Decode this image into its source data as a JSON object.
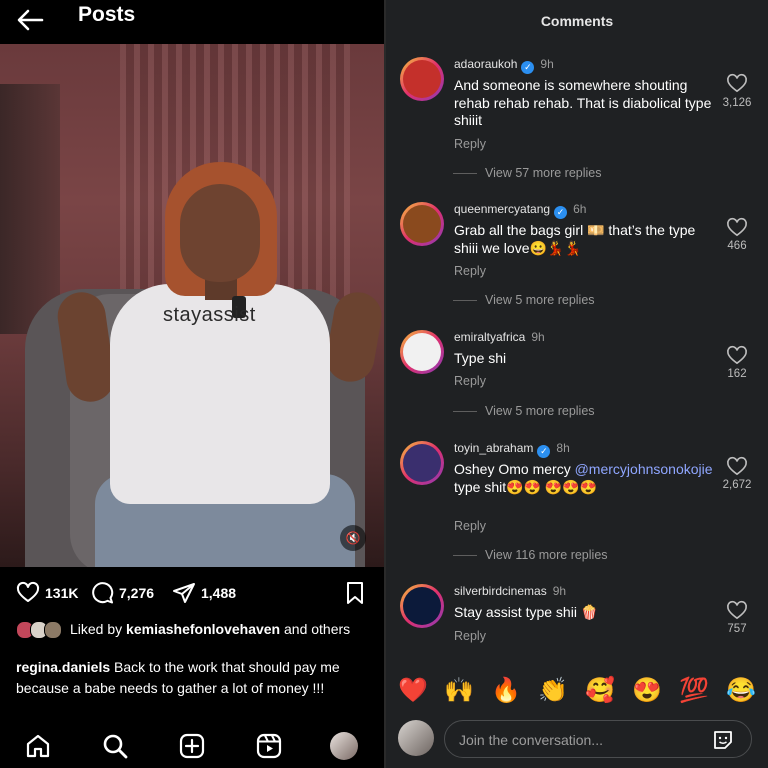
{
  "post_header": {
    "title": "Posts"
  },
  "video": {
    "shirt_text": "stayassist",
    "mute_icon": "speaker-muted-icon"
  },
  "actions": {
    "likes": "131K",
    "comments": "7,276",
    "shares": "1,488"
  },
  "liked_by": {
    "prefix": "Liked by ",
    "user": "kemiashefonlovehaven",
    "suffix": " and others"
  },
  "caption": {
    "user": "regina.daniels",
    "text": " Back to the work that should pay me because a babe needs to gather a lot of money !!!"
  },
  "comments_panel": {
    "title": "Comments",
    "comments": [
      {
        "user": "adaoraukoh",
        "verified": true,
        "time": "9h",
        "text": "And someone is somewhere shouting rehab rehab rehab. That is diabolical type shiiit",
        "reply": "Reply",
        "likes": "3,126",
        "view_more": "View 57 more replies",
        "avatar_color": "#c4302b"
      },
      {
        "user": "queenmercyatang",
        "verified": true,
        "time": "6h",
        "text": "Grab all the bags girl 💴 that’s the type shiii we love😀💃💃",
        "reply": "Reply",
        "likes": "466",
        "view_more": "View 5 more replies",
        "avatar_color": "#8a4a1e"
      },
      {
        "user": "emiraltyafrica",
        "verified": false,
        "time": "9h",
        "text": "Type shi",
        "reply": "Reply",
        "likes": "162",
        "view_more": "View 5 more replies",
        "avatar_color": "#f1f1f1"
      },
      {
        "user": "toyin_abraham",
        "verified": true,
        "time": "8h",
        "text_before": "Oshey Omo mercy ",
        "mention": "@mercyjohnsonokojie",
        "text_after": " type shit😍😍 😍😍😍",
        "reply": "Reply",
        "likes": "2,672",
        "view_more": "View 116 more replies",
        "avatar_color": "#3a2f6e"
      },
      {
        "user": "silverbirdcinemas",
        "verified": false,
        "time": "9h",
        "text": "Stay assist type shii 🍿",
        "reply": "Reply",
        "likes": "757",
        "avatar_color": "#0c1a3a"
      }
    ]
  },
  "emoji_bar": [
    "❤️",
    "🙌",
    "🔥",
    "👏",
    "🥰",
    "😍",
    "💯",
    "😂"
  ],
  "input": {
    "placeholder": "Join the conversation..."
  }
}
